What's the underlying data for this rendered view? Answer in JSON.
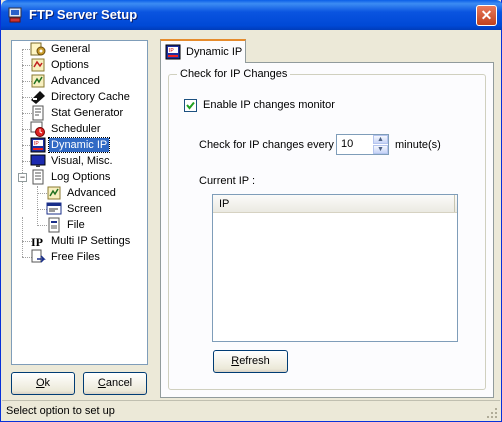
{
  "window": {
    "title": "FTP Server Setup",
    "close_glyph": "✕"
  },
  "tree": {
    "items": [
      {
        "label": "General",
        "icon": "general-icon"
      },
      {
        "label": "Options",
        "icon": "options-icon"
      },
      {
        "label": "Advanced",
        "icon": "advanced-icon"
      },
      {
        "label": "Directory Cache",
        "icon": "directory-cache-icon"
      },
      {
        "label": "Stat Generator",
        "icon": "stat-generator-icon"
      },
      {
        "label": "Scheduler",
        "icon": "scheduler-icon"
      },
      {
        "label": "Dynamic IP",
        "icon": "dynamic-ip-icon",
        "selected": true
      },
      {
        "label": "Visual, Misc.",
        "icon": "monitor-icon"
      },
      {
        "label": "Log Options",
        "icon": "log-options-icon",
        "expanded": true
      },
      {
        "label": "Advanced",
        "icon": "log-advanced-icon"
      },
      {
        "label": "Screen",
        "icon": "screen-icon"
      },
      {
        "label": "File",
        "icon": "file-icon"
      },
      {
        "label": "Multi IP Settings",
        "icon": "multi-ip-icon"
      },
      {
        "label": "Free Files",
        "icon": "free-files-icon"
      }
    ],
    "collapse_glyph": "−"
  },
  "buttons": {
    "ok_accel": "O",
    "ok_rest": "k",
    "cancel_accel": "C",
    "cancel_rest": "ancel",
    "refresh_accel": "R",
    "refresh_rest": "efresh"
  },
  "tab": {
    "label": "Dynamic IP"
  },
  "group": {
    "label": "Check for IP Changes",
    "enable_label": "Enable IP changes monitor",
    "enable_checked": true,
    "interval_prefix": "Check for IP changes every",
    "interval_value": "10",
    "interval_suffix": "minute(s)",
    "current_ip_label": "Current IP :",
    "list_columns": [
      "IP"
    ]
  },
  "status": {
    "text": "Select option to set up"
  },
  "colors": {
    "title_bar": "#0a54e0",
    "selection": "#316ac5",
    "window_bg": "#ece9d8"
  }
}
